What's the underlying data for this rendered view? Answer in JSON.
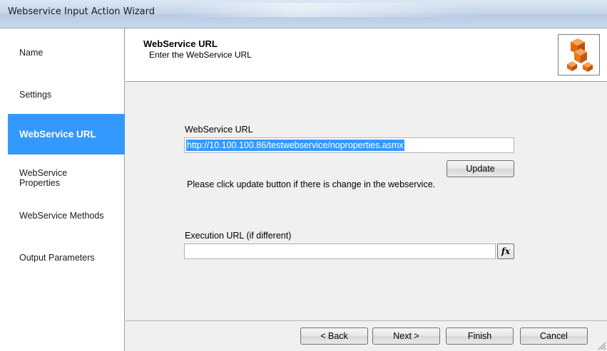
{
  "window": {
    "title": "Webservice Input Action Wizard"
  },
  "nav": {
    "items": [
      {
        "label": "Name",
        "active": false
      },
      {
        "label": "Settings",
        "active": false
      },
      {
        "label": "WebService URL",
        "active": true
      },
      {
        "label": "WebService Properties",
        "active": false
      },
      {
        "label": "WebService Methods",
        "active": false
      },
      {
        "label": "Output Parameters",
        "active": false
      }
    ]
  },
  "header": {
    "title": "WebService URL",
    "subtitle": "Enter the WebService URL",
    "logo_icon": "cubes-icon"
  },
  "form": {
    "url_label": "WebService URL",
    "url_value": "http://10.100.100.86/testwebservice/noproperties.asmx",
    "update_label": "Update",
    "hint": "Please click update button if there is change in the webservice.",
    "exec_label": "Execution URL (if different)",
    "exec_value": "",
    "fx_label": "fx",
    "fx_icon": "function-icon"
  },
  "footer": {
    "back_label": "< Back",
    "next_label": "Next >",
    "finish_label": "Finish",
    "cancel_label": "Cancel"
  },
  "colors": {
    "accent": "#3399ff",
    "logo_orange": "#e8741a"
  }
}
